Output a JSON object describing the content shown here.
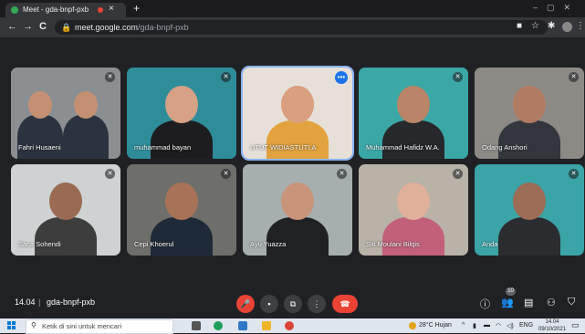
{
  "browser": {
    "tab_title": "Meet - gda-bnpf-pxb",
    "tab_close_glyph": "×",
    "new_tab_glyph": "+",
    "url_host": "meet.google.com",
    "url_path": "/gda-bnpf-pxb",
    "nav": {
      "back": "←",
      "forward": "→",
      "reload": "C"
    }
  },
  "participants": [
    {
      "name": "Fahri Husaeni",
      "bg": "#8c8f92",
      "muted": true,
      "people": 2,
      "skin": "#c49073",
      "shirt": "#2c3340"
    },
    {
      "name": "muhammad bayan",
      "bg": "#2f8d9a",
      "muted": true,
      "people": 1,
      "skin": "#d6a184",
      "shirt": "#1d1d1f"
    },
    {
      "name": "UTUT WIDIASTUTI.A",
      "bg": "#e6e0d8",
      "muted": false,
      "active": true,
      "people": 1,
      "skin": "#d99f7f",
      "shirt": "#e2a33e"
    },
    {
      "name": "Muhammad Hafidz W.A.",
      "bg": "#3ba7a7",
      "muted": true,
      "people": 1,
      "skin": "#b98468",
      "shirt": "#26282b"
    },
    {
      "name": "Odang Anshori",
      "bg": "#8d8a86",
      "muted": true,
      "people": 1,
      "skin": "#b07b62",
      "shirt": "#33373d"
    },
    {
      "name": "Saca Sohendi",
      "bg": "#cfd2d3",
      "muted": true,
      "people": 1,
      "skin": "#9a6b52",
      "shirt": "#3d3d3d"
    },
    {
      "name": "Cepi Khoerul",
      "bg": "#6e6f6a",
      "muted": true,
      "people": 1,
      "skin": "#a87256",
      "shirt": "#1f2a38"
    },
    {
      "name": "Ayu Yuazza",
      "bg": "#a7aeb0",
      "muted": true,
      "people": 1,
      "skin": "#c9957a",
      "shirt": "#1f2124"
    },
    {
      "name": "Siti Moulani Bilqis",
      "bg": "#b8b2a7",
      "muted": true,
      "people": 1,
      "skin": "#e0b09a",
      "shirt": "#c2607a"
    },
    {
      "name": "Anda",
      "bg": "#3aa4a6",
      "muted": true,
      "people": 1,
      "skin": "#9c6c55",
      "shirt": "#2a2c30"
    }
  ],
  "meet_bar": {
    "time": "14.04",
    "separator": "|",
    "code": "gda-bnpf-pxb",
    "participant_count": "10"
  },
  "taskbar": {
    "search_placeholder": "Ketik di sini untuk mencari",
    "weather": "28°C  Hujan",
    "lang": "ENG",
    "time": "14.04",
    "date": "09/10/2021"
  },
  "colors": {
    "leave": "#ea4335",
    "accent": "#8ab4f8",
    "background": "#202124"
  }
}
